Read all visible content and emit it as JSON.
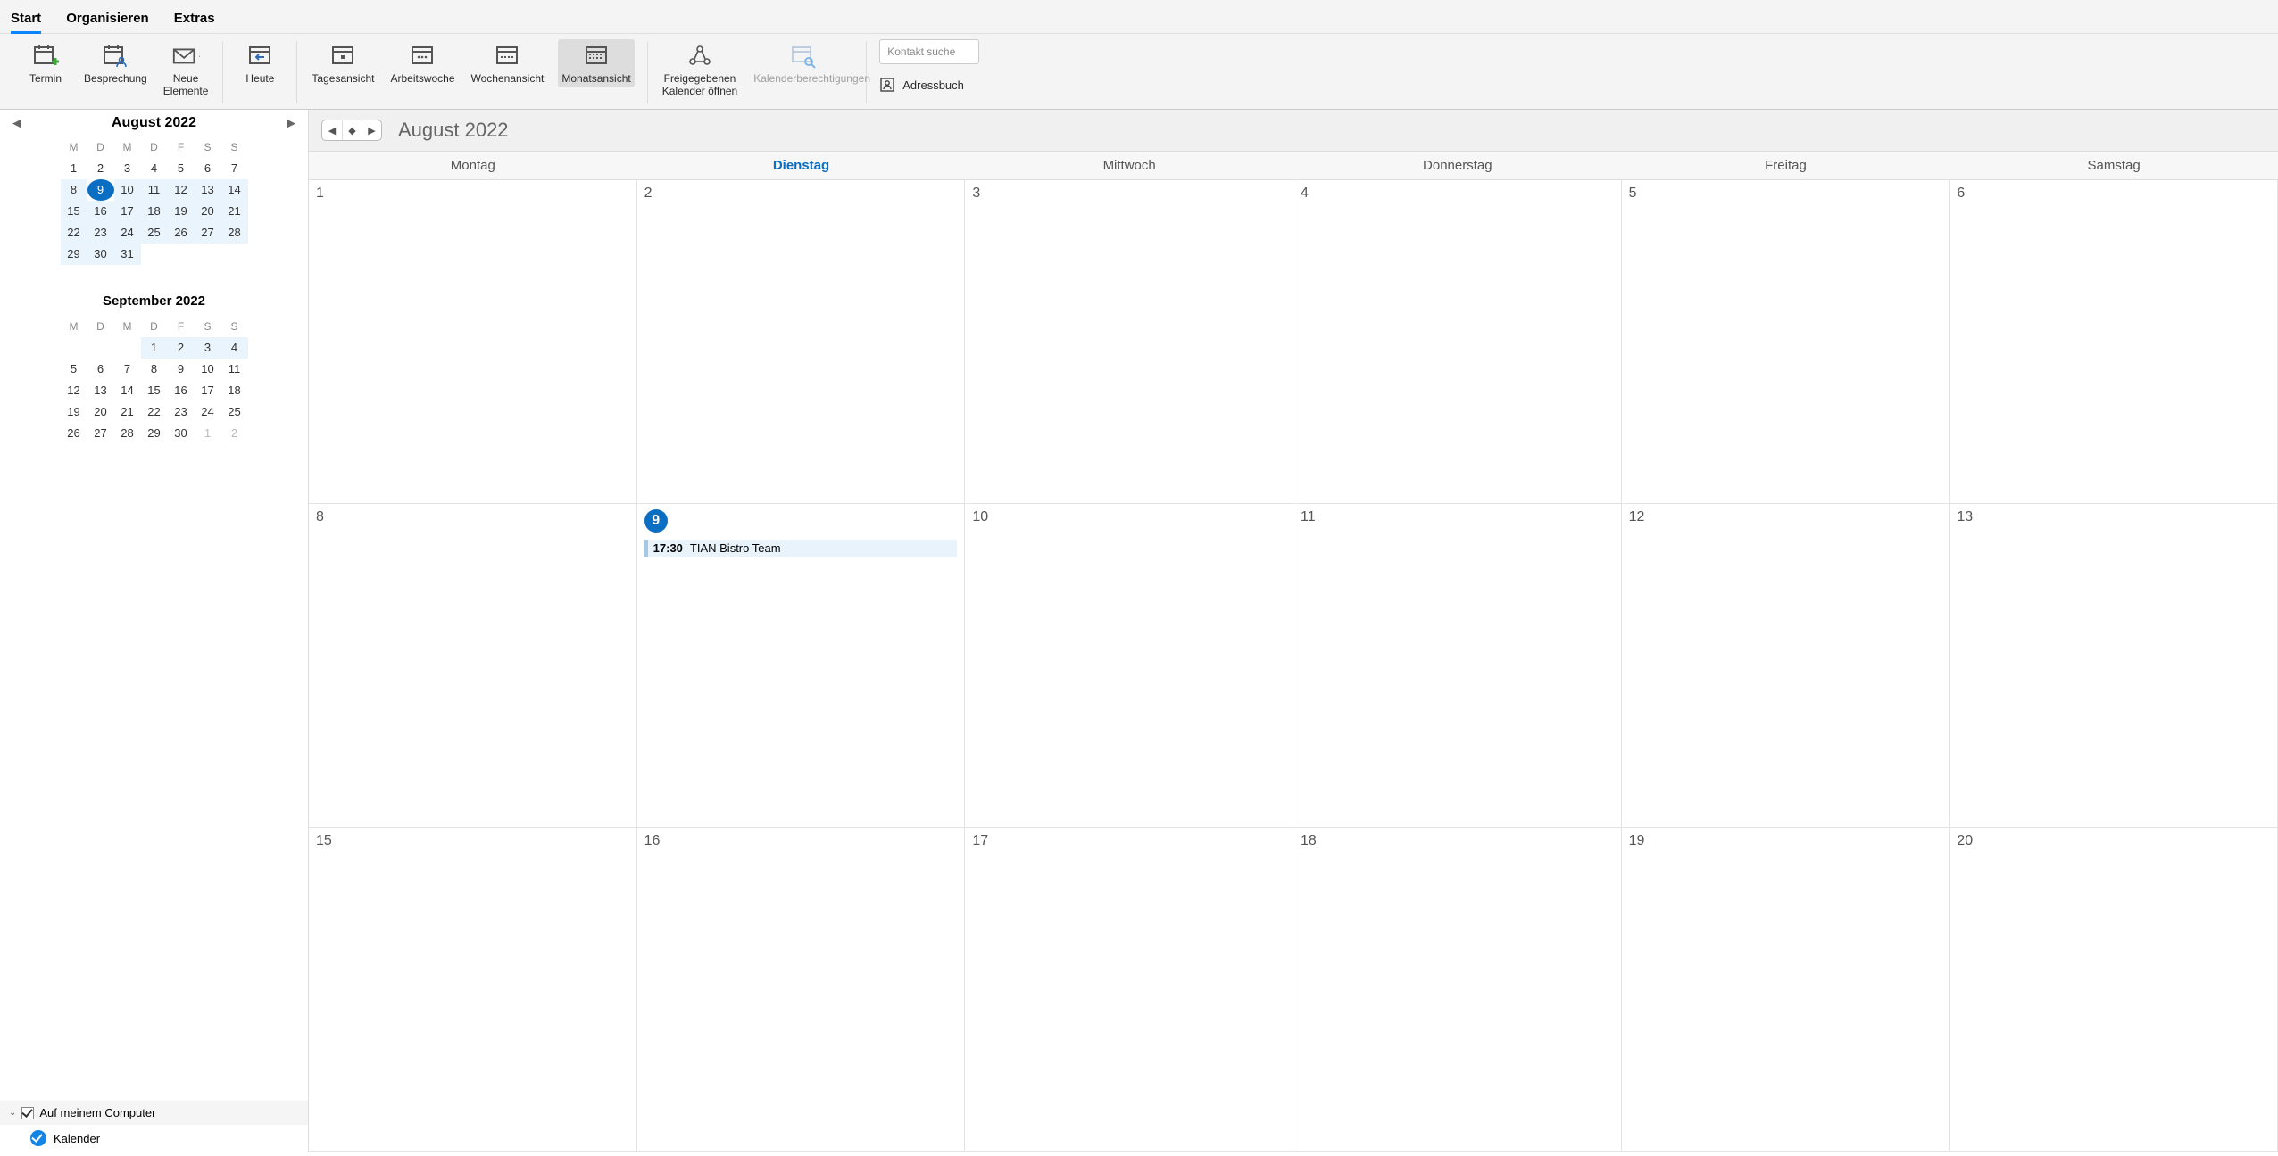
{
  "tabs": {
    "start": "Start",
    "organize": "Organisieren",
    "extras": "Extras"
  },
  "ribbon": {
    "termin": "Termin",
    "besprechung": "Besprechung",
    "neue_elemente": "Neue\nElemente",
    "heute": "Heute",
    "tagesansicht": "Tagesansicht",
    "arbeitswoche": "Arbeitswoche",
    "wochenansicht": "Wochenansicht",
    "monatsansicht": "Monatsansicht",
    "freigegebenen": "Freigegebenen\nKalender öffnen",
    "berechtigungen": "Kalenderberechtigungen",
    "adressbuch": "Adressbuch"
  },
  "search_placeholder": "Kontakt suche",
  "mini": {
    "month1_title": "August 2022",
    "month2_title": "September 2022",
    "weekdays": [
      "M",
      "D",
      "M",
      "D",
      "F",
      "S",
      "S"
    ],
    "aug_days": [
      1,
      2,
      3,
      4,
      5,
      6,
      7,
      8,
      9,
      10,
      11,
      12,
      13,
      14,
      15,
      16,
      17,
      18,
      19,
      20,
      21,
      22,
      23,
      24,
      25,
      26,
      27,
      28,
      29,
      30,
      31
    ],
    "sep_lead": [
      1,
      2,
      3,
      4
    ],
    "sep_days": [
      5,
      6,
      7,
      8,
      9,
      10,
      11,
      12,
      13,
      14,
      15,
      16,
      17,
      18,
      19,
      20,
      21,
      22,
      23,
      24,
      25,
      26,
      27,
      28,
      29,
      30
    ],
    "sep_trail": [
      1,
      2
    ],
    "today": 9
  },
  "tree": {
    "group": "Auf meinem Computer",
    "calendar": "Kalender"
  },
  "cal": {
    "title": "August 2022",
    "day_headers": [
      "Montag",
      "Dienstag",
      "Mittwoch",
      "Donnerstag",
      "Freitag",
      "Samstag"
    ],
    "today_col": 1,
    "weeks": [
      [
        "1",
        "2",
        "3",
        "4",
        "5",
        "6"
      ],
      [
        "8",
        "9",
        "10",
        "11",
        "12",
        "13"
      ],
      [
        "15",
        "16",
        "17",
        "18",
        "19",
        "20"
      ]
    ],
    "event": {
      "week": 1,
      "col": 1,
      "time": "17:30",
      "title": "TIAN Bistro Team"
    }
  }
}
